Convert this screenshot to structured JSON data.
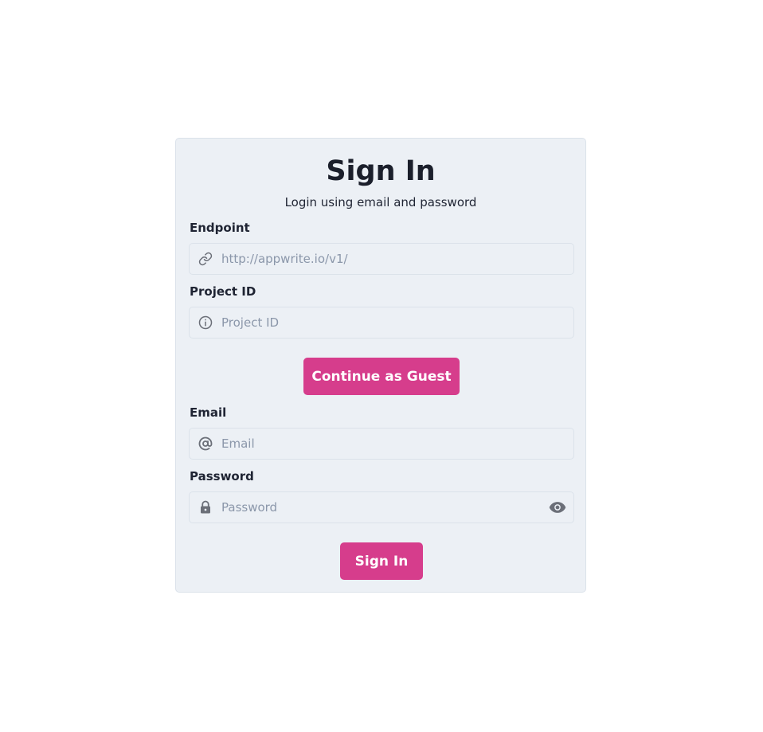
{
  "title": "Sign In",
  "subtitle": "Login using email and password",
  "endpoint": {
    "label": "Endpoint",
    "placeholder": "http://appwrite.io/v1/",
    "value": "",
    "icon": "link-icon"
  },
  "project": {
    "label": "Project ID",
    "placeholder": "Project ID",
    "value": "",
    "icon": "info-icon"
  },
  "guest_button": "Continue as Guest",
  "email": {
    "label": "Email",
    "placeholder": "Email",
    "value": "",
    "icon": "at-icon"
  },
  "password": {
    "label": "Password",
    "placeholder": "Password",
    "value": "",
    "icon": "lock-icon",
    "toggle_icon": "eye-icon"
  },
  "signin_button": "Sign In",
  "colors": {
    "accent": "#d63d8c",
    "card_bg": "#ecf0f5",
    "border": "#dbe2ea",
    "placeholder": "#8b97aa",
    "icon": "#6b6f78"
  }
}
